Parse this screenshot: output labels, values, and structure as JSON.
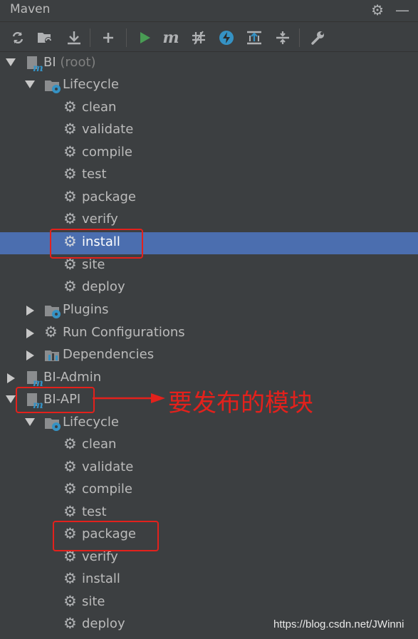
{
  "panel": {
    "title": "Maven",
    "settings_icon": "gear-icon",
    "hide_icon": "minimize-icon"
  },
  "toolbar": [
    {
      "name": "reload-icon"
    },
    {
      "name": "add-folder-icon"
    },
    {
      "name": "download-icon"
    },
    {
      "name": "add-icon"
    },
    {
      "name": "run-icon"
    },
    {
      "name": "maven-goal-icon"
    },
    {
      "name": "toggle-offline-icon"
    },
    {
      "name": "skip-tests-icon"
    },
    {
      "name": "show-dependencies-icon"
    },
    {
      "name": "collapse-all-icon"
    },
    {
      "name": "settings-wrench-icon"
    }
  ],
  "tree": {
    "root": {
      "name": "BI",
      "suffix": "(root)"
    },
    "lifecycle_label": "Lifecycle",
    "plugins_label": "Plugins",
    "run_config_label": "Run Configurations",
    "dependencies_label": "Dependencies",
    "goals": [
      "clean",
      "validate",
      "compile",
      "test",
      "package",
      "verify",
      "install",
      "site",
      "deploy"
    ],
    "selected_goal": "install",
    "modules": [
      "BI-Admin",
      "BI-API"
    ]
  },
  "annotation": {
    "text": "要发布的模块",
    "color": "#e3211c"
  },
  "watermark": "https://blog.csdn.net/JWinni",
  "colors": {
    "background": "#3c3f41",
    "selection": "#4b6eaf",
    "text": "#bbbbbb",
    "run_green": "#499c54",
    "accent_blue": "#3592c4"
  }
}
